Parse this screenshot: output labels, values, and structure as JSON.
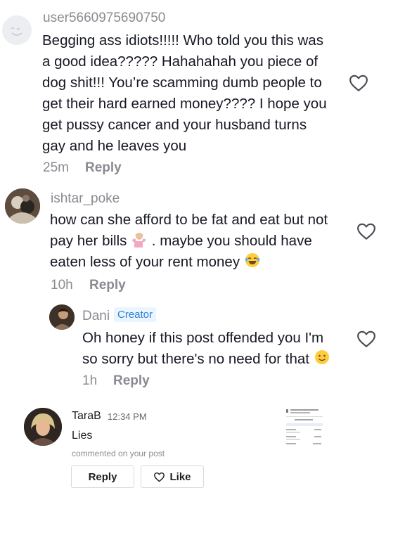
{
  "comments": [
    {
      "username": "user5660975690750",
      "lines": [
        "Begging ass idiots!!!!! Who told you this was",
        "a good idea????? Hahahahah you piece of",
        "dog shit!!! You’re scamming dumb people to",
        "get their hard earned money???? I hope you",
        "get pussy cancer and your husband turns",
        "gay and he leaves you"
      ],
      "time": "25m",
      "reply_label": "Reply"
    },
    {
      "username": "ishtar_poke",
      "line1": "how can she afford to be fat and eat but not",
      "line2a": "pay her bills",
      "line2b": ". maybe you should have",
      "line3": "eaten less of your rent money",
      "time": "10h",
      "reply_label": "Reply"
    },
    {
      "username": "Dani",
      "badge": "Creator",
      "line1": "Oh honey if this post offended you I'm",
      "line2": "so sorry but there's no need for that",
      "time": "1h",
      "reply_label": "Reply"
    }
  ],
  "notification": {
    "name": "TaraB",
    "time": "12:34 PM",
    "text": "Lies",
    "subtext": "commented on your post",
    "reply_button": "Reply",
    "like_button": "Like"
  },
  "icons": {
    "heart": "heart-icon",
    "shrug": "person-shrugging-emoji",
    "laugh": "tears-of-joy-emoji",
    "smile": "slightly-smiling-emoji"
  },
  "colors": {
    "text": "#161823",
    "muted": "#8a8b91",
    "badge_text": "#2b7fd6",
    "badge_bg": "#eaf5ff"
  }
}
